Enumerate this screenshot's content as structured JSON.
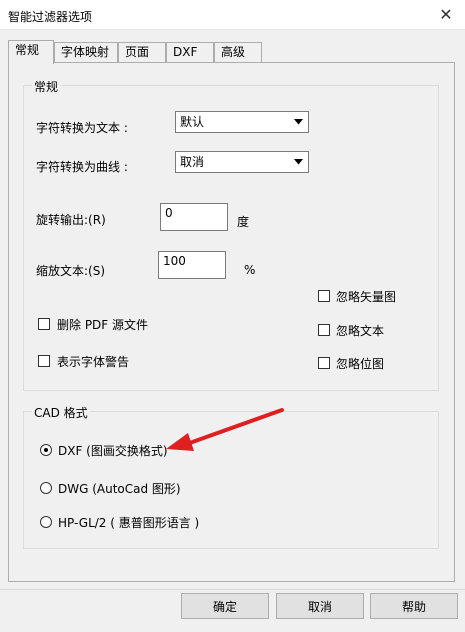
{
  "window": {
    "title": "智能过滤器选项",
    "close_glyph": "✕"
  },
  "tabs": [
    {
      "label": "常规",
      "active": true
    },
    {
      "label": "字体映射",
      "active": false
    },
    {
      "label": "页面",
      "active": false
    },
    {
      "label": "DXF",
      "active": false
    },
    {
      "label": "高级",
      "active": false
    }
  ],
  "general": {
    "group_label": "常规",
    "text_conversion": {
      "label": "字符转换为文本 :",
      "value": "默认"
    },
    "curve_conversion": {
      "label": "字符转换为曲线 :",
      "value": "取消"
    },
    "rotation": {
      "label": "旋转输出:(R)",
      "value": "0",
      "unit": "度"
    },
    "scale": {
      "label": "缩放文本:(S)",
      "value": "100",
      "unit": "%"
    },
    "checkboxes": {
      "ignore_vector": "忽略矢量图",
      "delete_pdf": "删除 PDF 源文件",
      "ignore_text": "忽略文本",
      "show_font_warning": "表示字体警告",
      "ignore_bitmap": "忽略位图"
    }
  },
  "cad": {
    "group_label": "CAD 格式",
    "options": [
      {
        "label": "DXF (图画交换格式)",
        "selected": true
      },
      {
        "label": "DWG (AutoCad 图形)",
        "selected": false
      },
      {
        "label": "HP-GL/2 ( 惠普图形语言 )",
        "selected": false
      }
    ]
  },
  "buttons": {
    "ok": "确定",
    "cancel": "取消",
    "help": "帮助"
  },
  "colors": {
    "annotation_arrow": "#e02020"
  }
}
